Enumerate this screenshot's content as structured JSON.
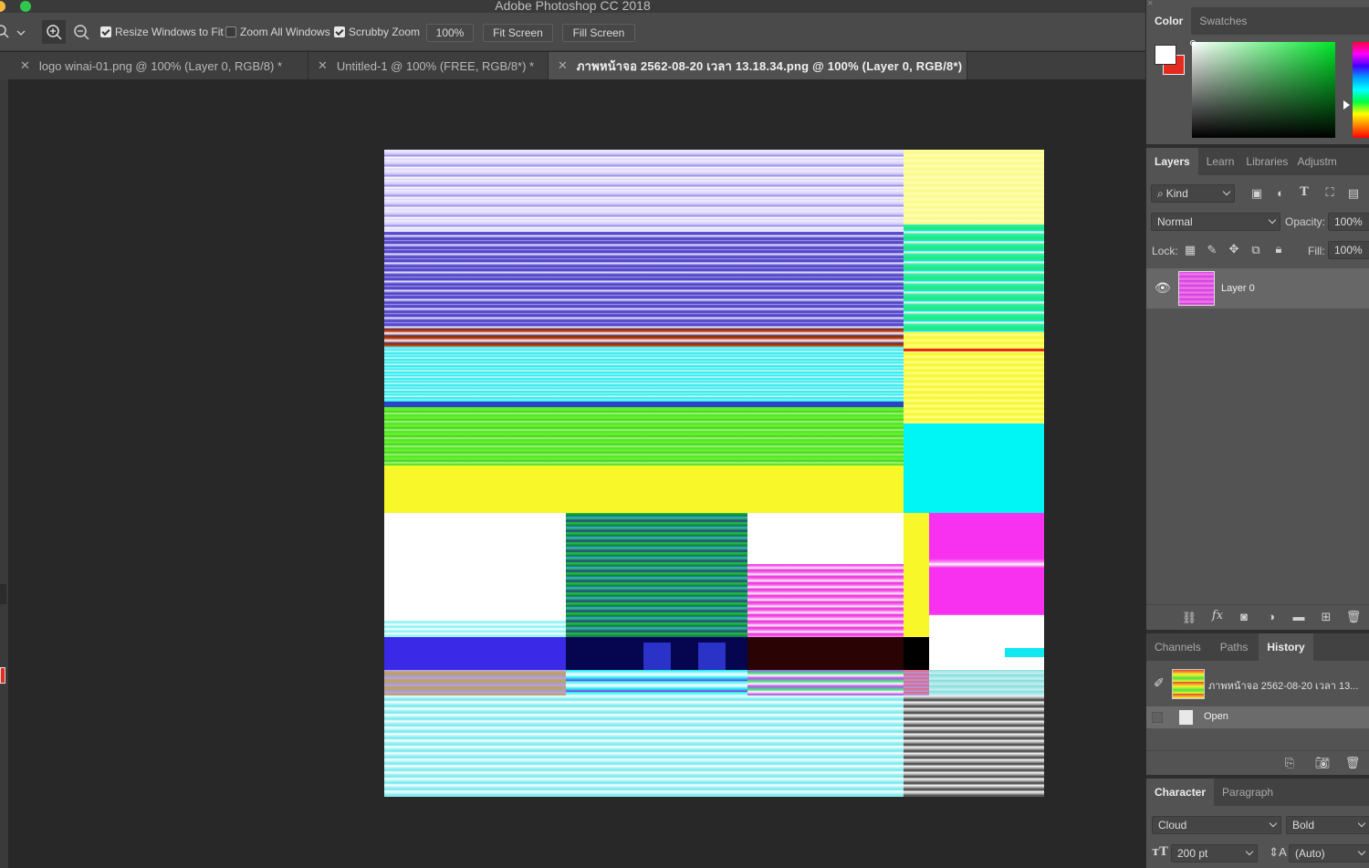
{
  "window": {
    "title": "Adobe Photoshop CC 2018"
  },
  "options_bar": {
    "resize_windows_label": "Resize Windows to Fit",
    "zoom_all_label": "Zoom All Windows",
    "scrubby_zoom_label": "Scrubby Zoom",
    "zoom_value": "100%",
    "fit_screen_label": "Fit Screen",
    "fill_screen_label": "Fill Screen",
    "resize_windows_checked": true,
    "zoom_all_checked": false,
    "scrubby_zoom_checked": true
  },
  "doc_tabs": [
    {
      "label": "logo winai-01.png @ 100% (Layer 0, RGB/8) *",
      "active": false
    },
    {
      "label": "Untitled-1 @ 100% (FREE, RGB/8*) *",
      "active": false
    },
    {
      "label": "ภาพหน้าจอ 2562-08-20 เวลา 13.18.34.png @ 100% (Layer 0, RGB/8*)",
      "active": true
    }
  ],
  "color_panel": {
    "tabs": [
      "Color",
      "Swatches"
    ],
    "foreground": "#ffffff",
    "background": "#e52b1e",
    "hue_color": "#00ff2a"
  },
  "layers_panel": {
    "tabs": [
      "Layers",
      "Learn",
      "Libraries",
      "Adjustm"
    ],
    "filter_kind": "Kind",
    "blend_mode": "Normal",
    "opacity_label": "Opacity:",
    "opacity_value": "100%",
    "lock_label": "Lock:",
    "fill_label": "Fill:",
    "fill_value": "100%",
    "layers": [
      {
        "name": "Layer 0",
        "visible": true
      }
    ]
  },
  "history_panel": {
    "tabs": [
      "Channels",
      "Paths",
      "History"
    ],
    "snapshot_label": "ภาพหน้าจอ 2562-08-20 เวลา 13...",
    "states": [
      {
        "label": "Open"
      }
    ]
  },
  "character_panel": {
    "tabs": [
      "Character",
      "Paragraph"
    ],
    "font_family": "Cloud",
    "font_style": "Bold",
    "font_size": "200 pt",
    "leading": "(Auto)"
  }
}
